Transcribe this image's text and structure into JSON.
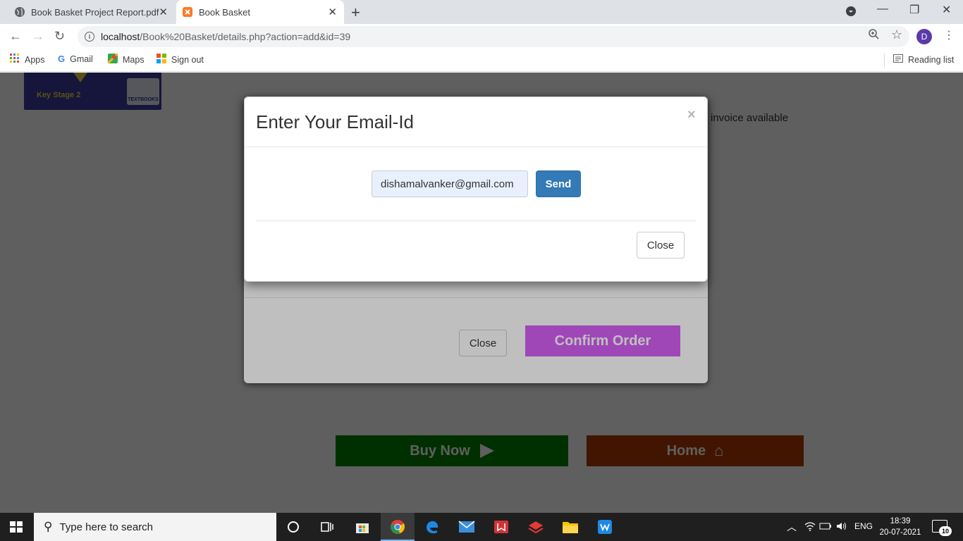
{
  "browser": {
    "tabs": [
      {
        "title": "Book Basket Project Report.pdf",
        "close": "✕"
      },
      {
        "title": "Book Basket",
        "close": "✕"
      }
    ],
    "new_tab": "+",
    "address": {
      "host": "localhost",
      "path": "/Book%20Basket/details.php?action=add&id=39"
    },
    "profile_initial": "D",
    "bookmarks": [
      "Apps",
      "Gmail",
      "Maps",
      "Sign out"
    ],
    "reading_list": "Reading list"
  },
  "page": {
    "book_label": "Key Stage 2",
    "book_badge": "TEXTBOOKS",
    "side_text": "invoice available",
    "buy_now": "Buy Now",
    "home": "Home"
  },
  "order_modal": {
    "close_label": "Close",
    "confirm_label": "Confirm Order"
  },
  "email_modal": {
    "title": "Enter Your Email-Id",
    "close_x": "×",
    "email_value": "dishamalvanker@gmail.com",
    "send_label": "Send",
    "close_label": "Close"
  },
  "taskbar": {
    "search_placeholder": "Type here to search",
    "language": "ENG",
    "time": "18:39",
    "date": "20-07-2021",
    "notification_count": "10"
  },
  "colors": {
    "send_button": "#337ab7",
    "confirm_button": "#d45ff5",
    "buy_button": "#008000",
    "home_button": "#b33a00"
  }
}
